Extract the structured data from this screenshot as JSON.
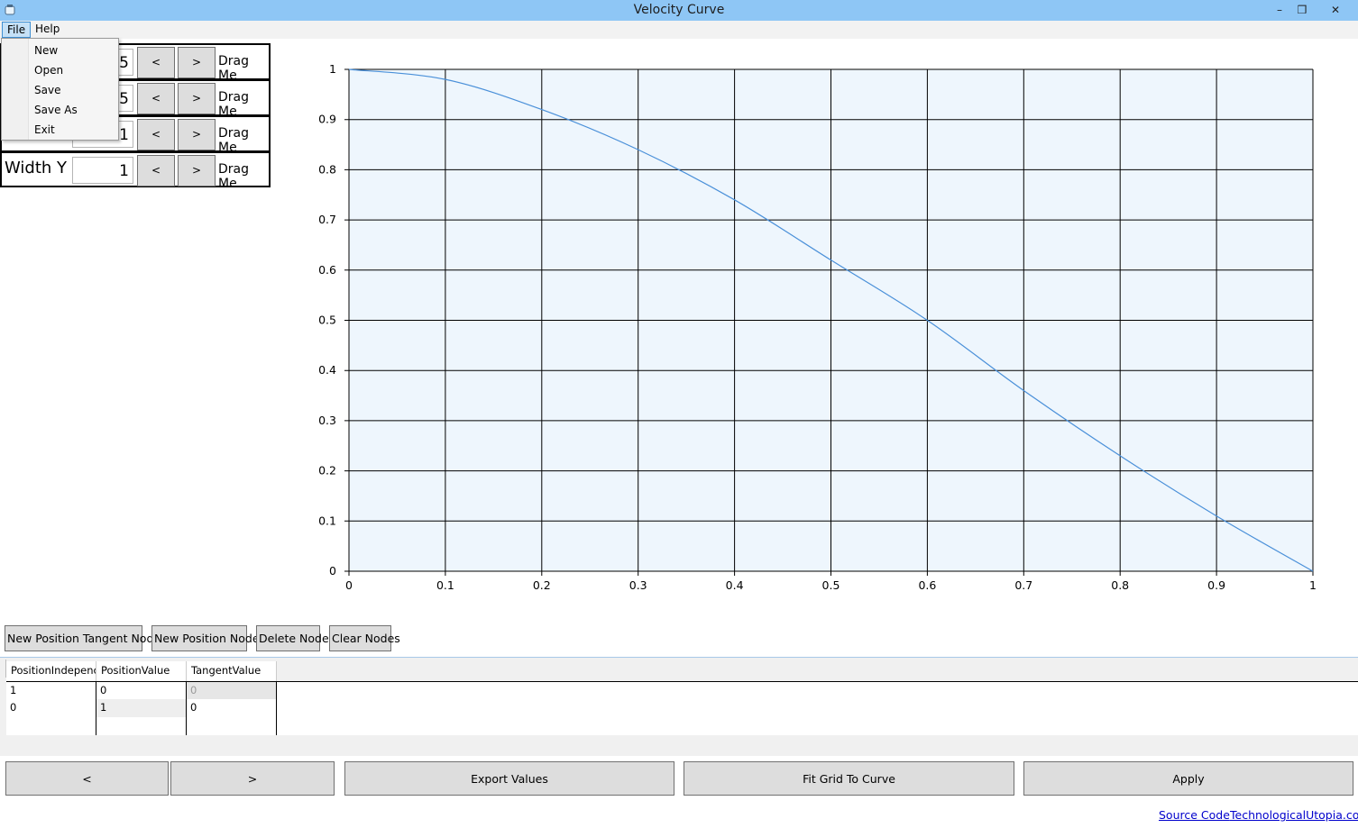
{
  "window": {
    "title": "Velocity Curve",
    "minimize_glyph": "–",
    "restore_glyph": "❒",
    "close_glyph": "✕"
  },
  "menu": {
    "file": "File",
    "help": "Help",
    "file_items": [
      "New",
      "Open",
      "Save",
      "Save As",
      "Exit"
    ]
  },
  "properties": [
    {
      "label": "",
      "value": "5",
      "dec": "<",
      "inc": ">",
      "drag": "Drag Me"
    },
    {
      "label": "",
      "value": "5",
      "dec": "<",
      "inc": ">",
      "drag": "Drag Me"
    },
    {
      "label": "",
      "value": "1",
      "dec": "<",
      "inc": ">",
      "drag": "Drag Me"
    },
    {
      "label": "Width Y",
      "value": "1",
      "dec": "<",
      "inc": ">",
      "drag": "Drag Me"
    }
  ],
  "chart_data": {
    "type": "line",
    "title": "",
    "xlabel": "",
    "ylabel": "",
    "xlim": [
      0,
      1
    ],
    "ylim": [
      0,
      1
    ],
    "grid": true,
    "x_ticks": [
      "0",
      "0.1",
      "0.2",
      "0.3",
      "0.4",
      "0.5",
      "0.6",
      "0.7",
      "0.8",
      "0.9",
      "1"
    ],
    "y_ticks": [
      "0",
      "0.1",
      "0.2",
      "0.3",
      "0.4",
      "0.5",
      "0.6",
      "0.7",
      "0.8",
      "0.9",
      "1"
    ],
    "series": [
      {
        "color": "#4a90d9",
        "x": [
          0,
          0.1,
          0.2,
          0.3,
          0.4,
          0.5,
          0.6,
          0.7,
          0.8,
          0.9,
          1
        ],
        "y": [
          1,
          0.98,
          0.92,
          0.84,
          0.74,
          0.62,
          0.5,
          0.36,
          0.23,
          0.11,
          0
        ]
      }
    ]
  },
  "toolbar": {
    "new_position_tangent_node": "New Position Tangent Node",
    "new_position_node": "New Position Node",
    "delete_node": "Delete Node",
    "clear_nodes": "Clear Nodes"
  },
  "table": {
    "columns": [
      "PositionIndepenc",
      "PositionValue",
      "TangentValue"
    ],
    "rows": [
      [
        "1",
        "0",
        "0"
      ],
      [
        "0",
        "1",
        "0"
      ],
      [
        "",
        "",
        ""
      ]
    ]
  },
  "bottom": {
    "prev": "<",
    "next": ">",
    "export": "Export Values",
    "fit": "Fit Grid To Curve",
    "apply": "Apply"
  },
  "footer": {
    "source_code": "Source Code",
    "site": "TechnologicalUtopia.com"
  }
}
